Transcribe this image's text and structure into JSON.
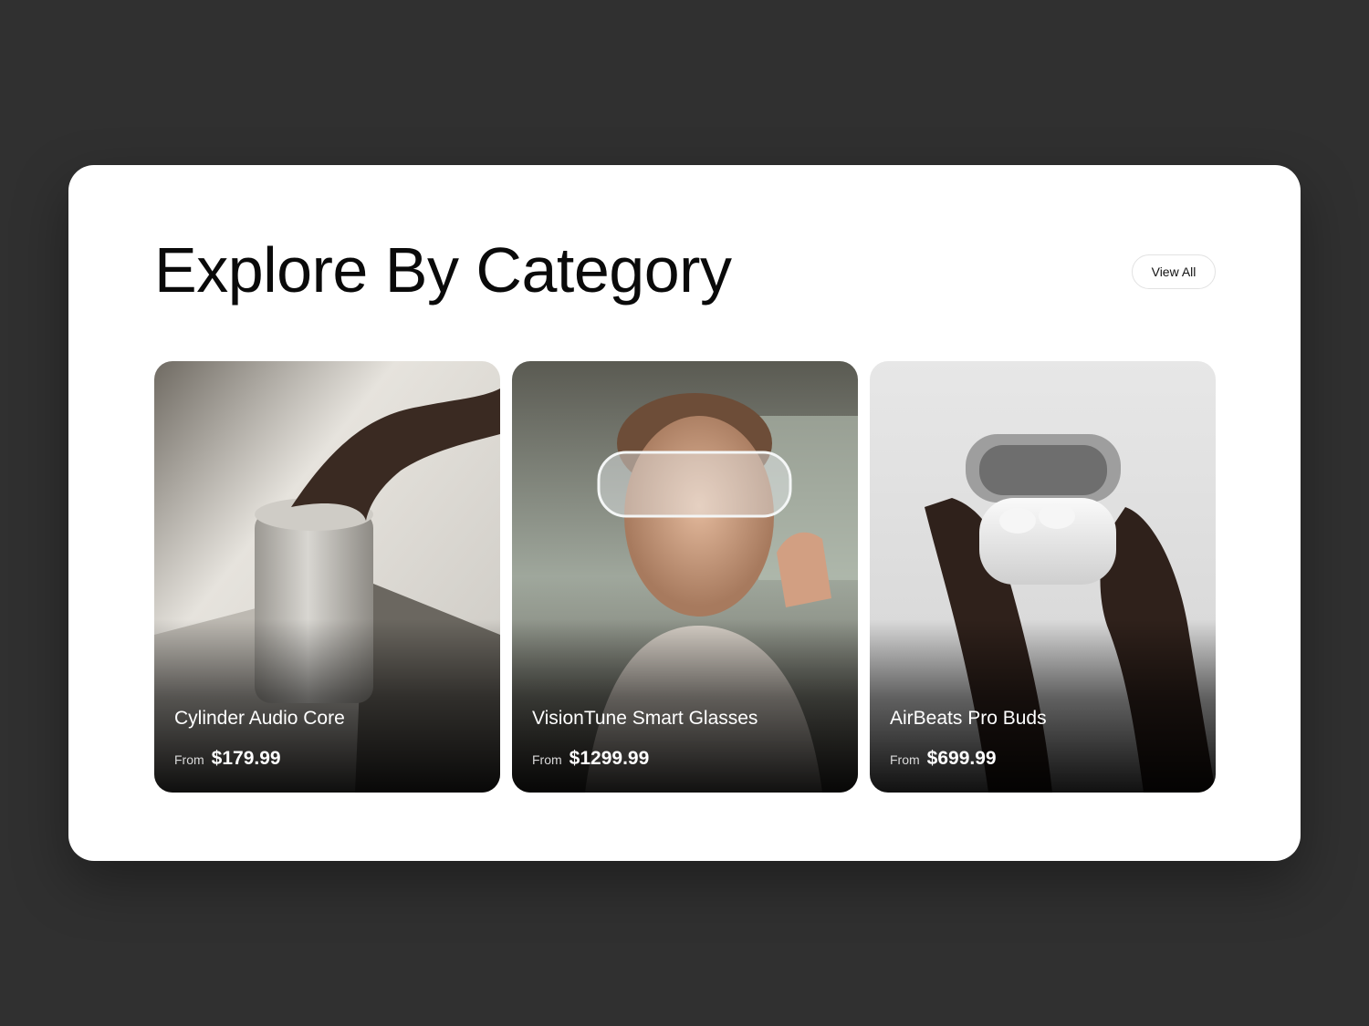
{
  "section": {
    "title": "Explore By Category",
    "view_all_label": "View All"
  },
  "products": [
    {
      "name": "Cylinder Audio Core",
      "from_label": "From",
      "price": "$179.99",
      "image_icon": "speaker-photo"
    },
    {
      "name": "VisionTune Smart Glasses",
      "from_label": "From",
      "price": "$1299.99",
      "image_icon": "smart-glasses-photo"
    },
    {
      "name": "AirBeats Pro Buds",
      "from_label": "From",
      "price": "$699.99",
      "image_icon": "earbuds-photo"
    }
  ],
  "colors": {
    "page_background": "#303030",
    "panel_background": "#ffffff",
    "text_dark": "#0a0a0a",
    "text_light": "#ffffff"
  }
}
